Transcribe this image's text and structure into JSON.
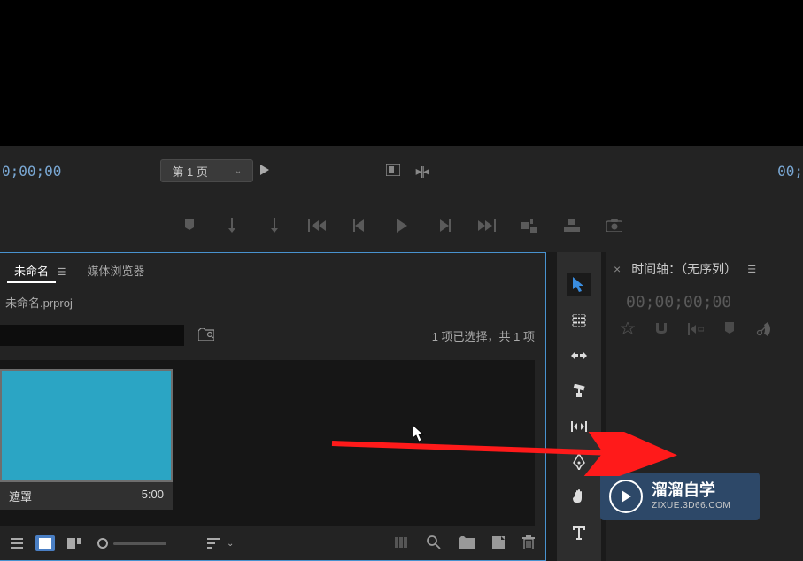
{
  "source_monitor": {
    "timecode_left": "0;00;00",
    "timecode_right": "00;",
    "page_label": "第 1 页"
  },
  "project": {
    "tab_name": "未命名",
    "media_browser_tab": "媒体浏览器",
    "filename": "未命名.prproj",
    "selection_info": "1 项已选择，共 1 项",
    "media_item_name": "遮罩",
    "media_item_duration": "5:00"
  },
  "timeline": {
    "title": "时间轴：（无序列）",
    "timecode": "00;00;00;00"
  },
  "watermark": {
    "main": "溜溜自学",
    "sub": "ZIXUE.3D66.COM"
  }
}
